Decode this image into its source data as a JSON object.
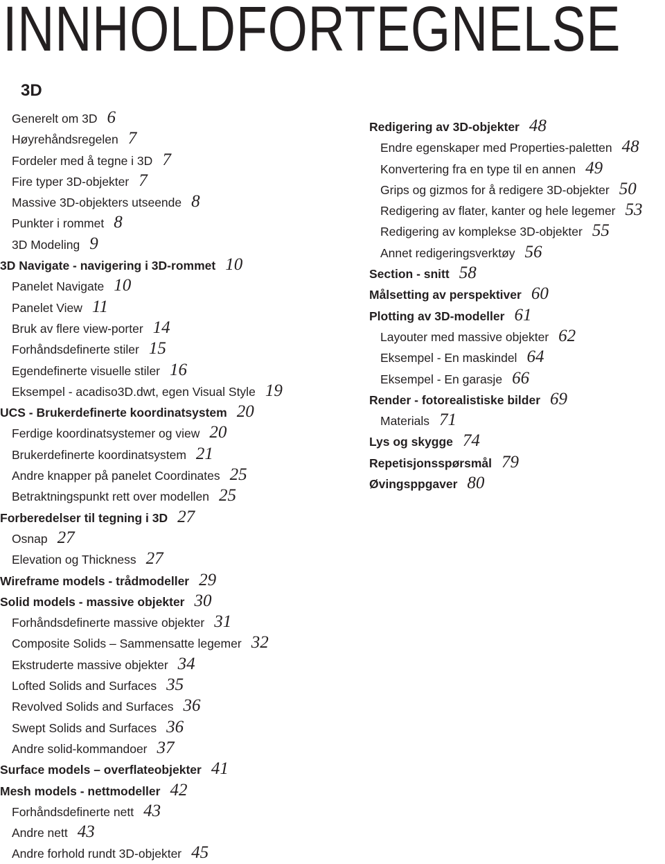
{
  "title": "INNHOLDFORTEGNELSE",
  "section": "3D",
  "left_column": [
    {
      "level": 2,
      "label": "Generelt om 3D",
      "page": "6"
    },
    {
      "level": 2,
      "label": "Høyrehåndsregelen",
      "page": "7"
    },
    {
      "level": 2,
      "label": "Fordeler med å tegne i 3D",
      "page": "7"
    },
    {
      "level": 2,
      "label": "Fire typer 3D-objekter",
      "page": "7"
    },
    {
      "level": 2,
      "label": "Massive 3D-objekters utseende",
      "page": "8"
    },
    {
      "level": 2,
      "label": "Punkter i rommet",
      "page": "8"
    },
    {
      "level": 2,
      "label": "3D Modeling",
      "page": "9"
    },
    {
      "level": 1,
      "label": "3D Navigate - navigering i 3D-rommet",
      "page": "10"
    },
    {
      "level": 2,
      "label": "Panelet Navigate",
      "page": "10"
    },
    {
      "level": 2,
      "label": "Panelet View",
      "page": "11"
    },
    {
      "level": 2,
      "label": "Bruk av flere view-porter",
      "page": "14"
    },
    {
      "level": 2,
      "label": "Forhåndsdefinerte stiler",
      "page": "15"
    },
    {
      "level": 2,
      "label": "Egendefinerte visuelle stiler",
      "page": "16"
    },
    {
      "level": 2,
      "label": "Eksempel - acadiso3D.dwt, egen Visual Style",
      "page": "19"
    },
    {
      "level": 1,
      "label": "UCS - Brukerdefinerte koordinatsystem",
      "page": "20"
    },
    {
      "level": 2,
      "label": "Ferdige koordinatsystemer og view",
      "page": "20"
    },
    {
      "level": 2,
      "label": "Brukerdefinerte koordinatsystem",
      "page": "21"
    },
    {
      "level": 2,
      "label": "Andre knapper på panelet Coordinates",
      "page": "25"
    },
    {
      "level": 2,
      "label": "Betraktningspunkt rett over modellen",
      "page": "25"
    },
    {
      "level": 1,
      "label": "Forberedelser til tegning i 3D",
      "page": "27"
    },
    {
      "level": 2,
      "label": "Osnap",
      "page": "27"
    },
    {
      "level": 2,
      "label": "Elevation og Thickness",
      "page": "27"
    },
    {
      "level": 1,
      "label": "Wireframe models - trådmodeller",
      "page": "29"
    },
    {
      "level": 1,
      "label": "Solid models - massive objekter",
      "page": "30"
    },
    {
      "level": 2,
      "label": "Forhåndsdefinerte massive objekter",
      "page": "31"
    },
    {
      "level": 2,
      "label": "Composite Solids – Sammensatte legemer",
      "page": "32"
    },
    {
      "level": 2,
      "label": "Ekstruderte massive objekter",
      "page": "34"
    },
    {
      "level": 2,
      "label": "Lofted Solids and Surfaces",
      "page": "35"
    },
    {
      "level": 2,
      "label": "Revolved Solids and Surfaces",
      "page": "36"
    },
    {
      "level": 2,
      "label": "Swept Solids and Surfaces",
      "page": "36"
    },
    {
      "level": 2,
      "label": "Andre solid-kommandoer",
      "page": "37"
    },
    {
      "level": 1,
      "label": "Surface models – overflateobjekter",
      "page": "41"
    },
    {
      "level": 1,
      "label": "Mesh models - nettmodeller",
      "page": "42"
    },
    {
      "level": 2,
      "label": "Forhåndsdefinerte nett",
      "page": "43"
    },
    {
      "level": 2,
      "label": "Andre nett",
      "page": "43"
    },
    {
      "level": 2,
      "label": "Andre forhold rundt 3D-objekter",
      "page": "45"
    }
  ],
  "right_column": [
    {
      "level": 1,
      "label": "Redigering av 3D-objekter",
      "page": "48"
    },
    {
      "level": 2,
      "label": "Endre egenskaper med Properties-paletten",
      "page": "48"
    },
    {
      "level": 2,
      "label": "Konvertering fra en type til en annen",
      "page": "49"
    },
    {
      "level": 2,
      "label": "Grips og gizmos for å redigere 3D-objekter",
      "page": "50"
    },
    {
      "level": 2,
      "label": "Redigering av flater, kanter og hele legemer",
      "page": "53"
    },
    {
      "level": 2,
      "label": "Redigering av komplekse 3D-objekter",
      "page": "55"
    },
    {
      "level": 2,
      "label": "Annet redigeringsverktøy",
      "page": "56"
    },
    {
      "level": 1,
      "label": "Section - snitt",
      "page": "58"
    },
    {
      "level": 1,
      "label": "Målsetting av perspektiver",
      "page": "60"
    },
    {
      "level": 1,
      "label": "Plotting av 3D-modeller",
      "page": "61"
    },
    {
      "level": 2,
      "label": "Layouter med massive objekter",
      "page": "62"
    },
    {
      "level": 2,
      "label": "Eksempel - En maskindel",
      "page": "64"
    },
    {
      "level": 2,
      "label": "Eksempel - En garasje",
      "page": "66"
    },
    {
      "level": 1,
      "label": "Render - fotorealistiske bilder",
      "page": "69"
    },
    {
      "level": 2,
      "label": "Materials",
      "page": "71"
    },
    {
      "level": 1,
      "label": "Lys og skygge",
      "page": "74"
    },
    {
      "level": 1,
      "label": "Repetisjonsspørsmål",
      "page": "79"
    },
    {
      "level": 1,
      "label": "Øvingsppgaver",
      "page": "80"
    }
  ]
}
